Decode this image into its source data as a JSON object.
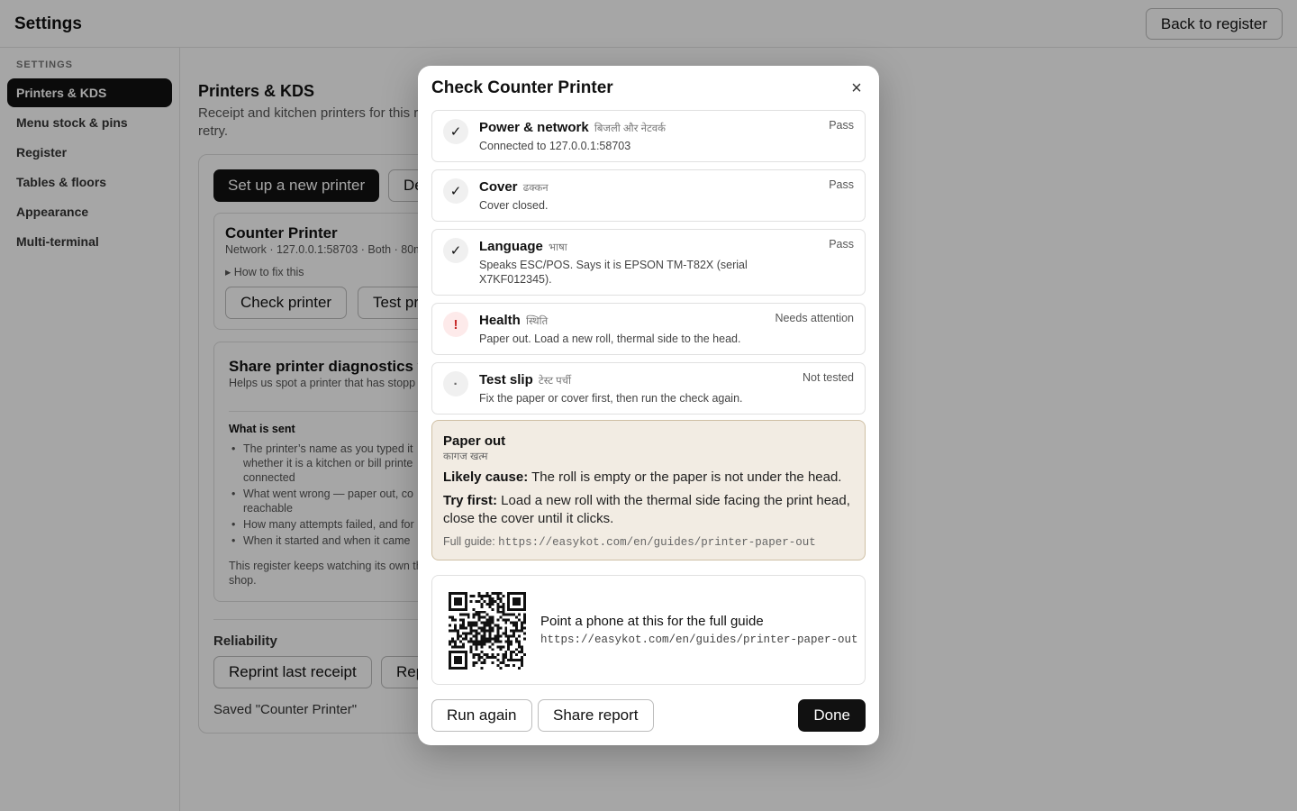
{
  "app": {
    "title": "Settings",
    "back_label": "Back to register"
  },
  "sidebar": {
    "heading": "SETTINGS",
    "items": [
      {
        "label": "Printers & KDS"
      },
      {
        "label": "Menu stock & pins"
      },
      {
        "label": "Register"
      },
      {
        "label": "Tables & floors"
      },
      {
        "label": "Appearance"
      },
      {
        "label": "Multi-terminal"
      }
    ]
  },
  "page": {
    "title": "Printers & KDS",
    "description": "Receipt and kitchen printers for this r retry.",
    "setup_label": "Set up a new printer",
    "second_label": "De",
    "printer": {
      "name": "Counter Printer",
      "meta": "Network · 127.0.0.1:58703 · Both · 80m",
      "howto": "▸ How to fix this",
      "check_label": "Check printer",
      "test_label": "Test pr"
    },
    "diagnostics": {
      "title": "Share printer diagnostics w",
      "desc": "Helps us spot a printer that has stopp",
      "what_sent": "What is sent",
      "bullets": [
        "The printer’s name as you typed it whether it is a kitchen or bill printe connected",
        "What went wrong — paper out, co reachable",
        "How many attempts failed, and for",
        "When it started and when it came"
      ],
      "footer": "This register keeps watching its own the shop."
    },
    "reliability": {
      "title": "Reliability",
      "reprint_label": "Reprint last receipt",
      "second_label": "Rep",
      "saved": "Saved \"Counter Printer\""
    }
  },
  "modal": {
    "title": "Check Counter Printer",
    "close_glyph": "×",
    "checks": [
      {
        "icon": "✓",
        "name": "Power & network",
        "sub": "बिजली और नेटवर्क",
        "detail": "Connected to 127.0.0.1:58703",
        "status": "Pass"
      },
      {
        "icon": "✓",
        "name": "Cover",
        "sub": "ढक्कन",
        "detail": "Cover closed.",
        "status": "Pass"
      },
      {
        "icon": "✓",
        "name": "Language",
        "sub": "भाषा",
        "detail": "Speaks ESC/POS. Says it is EPSON TM-T82X (serial X7KF012345).",
        "status": "Pass"
      },
      {
        "icon": "!",
        "name": "Health",
        "sub": "स्थिति",
        "detail": "Paper out. Load a new roll, thermal side to the head.",
        "status": "Needs attention"
      },
      {
        "icon": "·",
        "name": "Test slip",
        "sub": "टेस्ट पर्ची",
        "detail": "Fix the paper or cover first, then run the check again.",
        "status": "Not tested"
      }
    ],
    "help": {
      "title": "Paper out",
      "sub": "कागज खत्म",
      "cause_label": "Likely cause:",
      "cause_text": " The roll is empty or the paper is not under the head.",
      "try_label": "Try first:",
      "try_text": " Load a new roll with the thermal side facing the print head, close the cover until it clicks.",
      "guide_label": "Full guide: ",
      "guide_url": "https://easykot.com/en/guides/printer-paper-out"
    },
    "qr": {
      "title": "Point a phone at this for the full guide",
      "url": "https://easykot.com/en/guides/printer-paper-out"
    },
    "buttons": {
      "run_again": "Run again",
      "share": "Share report",
      "done": "Done"
    }
  }
}
